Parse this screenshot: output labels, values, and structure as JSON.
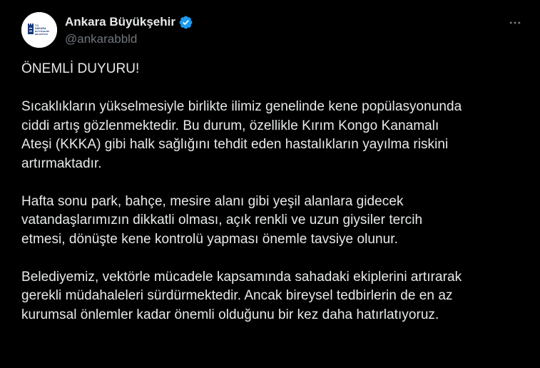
{
  "tweet": {
    "author": {
      "display_name": "Ankara Büyükşehir",
      "handle": "@ankarabbld",
      "verified": true,
      "avatar_icon": "ankara-municipality-logo",
      "avatar_text": [
        "T.C.",
        "ANKARA",
        "BÜYÜKŞEHİR",
        "BELEDİYESİ"
      ]
    },
    "more_icon": "more-horizontal-icon",
    "paragraphs": [
      "ÖNEMLİ DUYURU!",
      "Sıcaklıkların yükselmesiyle birlikte ilimiz genelinde kene popülasyonunda\nciddi artış gözlenmektedir. Bu durum, özellikle Kırım Kongo Kanamalı\nAteşi (KKKA) gibi halk sağlığını tehdit eden hastalıkların yayılma riskini\nartırmaktadır.",
      "Hafta sonu park, bahçe, mesire alanı gibi yeşil alanlara gidecek\nvatandaşlarımızın dikkatli olması, açık renkli ve uzun giysiler tercih\netmesi, dönüşte kene kontrolü yapması önemle tavsiye olunur.",
      "Belediyemiz, vektörle mücadele kapsamında sahadaki ekiplerini artırarak\ngerekli müdahaleleri sürdürmektedir. Ancak bireysel tedbirlerin de en az\nkurumsal önlemler kadar önemli olduğunu bir kez daha hatırlatıyoruz."
    ]
  },
  "colors": {
    "background": "#000000",
    "text": "#e7e9ea",
    "secondary_text": "#71767b",
    "verified_badge": "#1d9bf0",
    "logo_blue": "#1a3a7a"
  }
}
